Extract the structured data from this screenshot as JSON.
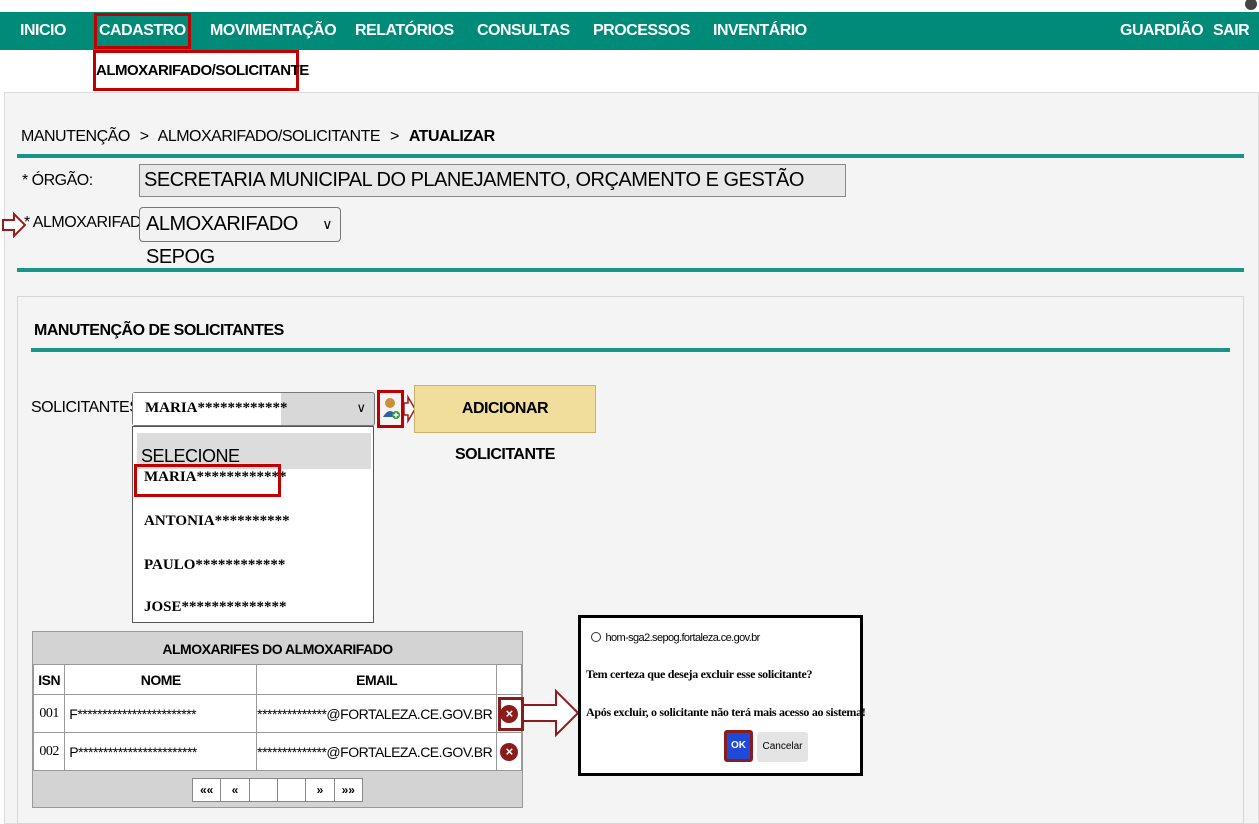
{
  "nav": {
    "items": [
      "INICIO",
      "CADASTRO",
      "MOVIMENTAÇÃO",
      "RELATÓRIOS",
      "CONSULTAS",
      "PROCESSOS",
      "INVENTÁRIO"
    ],
    "right_items": [
      "GUARDIÃO",
      "SAIR"
    ],
    "active": "CADASTRO",
    "submenu_item": "ALMOXARIFADO/SOLICITANTE"
  },
  "breadcrumb": {
    "part1": "MANUTENÇÃO",
    "sep": ">",
    "part2": "ALMOXARIFADO/SOLICITANTE",
    "current": "ATUALIZAR"
  },
  "form": {
    "orgao_label": "* ÓRGÃO:",
    "orgao_value": "SECRETARIA MUNICIPAL DO PLANEJAMENTO, ORÇAMENTO E GESTÃO",
    "almox_label": "* ALMOXARIFADO:",
    "almox_value": "ALMOXARIFADO SEPOG"
  },
  "solicitantes": {
    "section_title": "MANUTENÇÃO DE SOLICITANTES",
    "label": "SOLICITANTES:",
    "selected": "MARIA************",
    "add_button": "ADICIONAR SOLICITANTE",
    "options": [
      "SELECIONE",
      "MARIA************",
      "ANTONIA**********",
      "PAULO************",
      "JOSE**************"
    ]
  },
  "table": {
    "title": "ALMOXARIFES DO ALMOXARIFADO",
    "headers": [
      "ISN",
      "NOME",
      "EMAIL"
    ],
    "rows": [
      {
        "isn": "001",
        "nome": "F************************",
        "email": "**************@FORTALEZA.CE.GOV.BR"
      },
      {
        "isn": "002",
        "nome": "P************************",
        "email": "**************@FORTALEZA.CE.GOV.BR"
      }
    ],
    "pager": [
      "««",
      "«",
      "",
      "",
      "»",
      "»»"
    ]
  },
  "dialog": {
    "host": "hom-sga2.sepog.fortaleza.ce.gov.br",
    "question": "Tem certeza que deseja excluir esse solicitante?",
    "warning": "Após excluir, o solicitante não terá mais acesso ao sistema!",
    "ok": "OK",
    "cancel": "Cancelar"
  },
  "colors": {
    "nav_bg": "#008a78",
    "accent_line": "#1a9486",
    "highlight": "#c00000",
    "add_button_bg": "#f1de9c",
    "ok_button_bg": "#1f49d8"
  }
}
